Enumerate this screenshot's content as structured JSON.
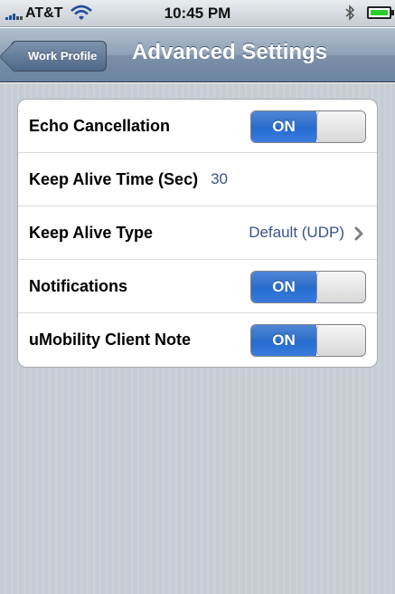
{
  "status_bar": {
    "carrier": "AT&T",
    "time": "10:45 PM",
    "icons": [
      "signal-bars-icon",
      "wifi-icon",
      "bluetooth-icon",
      "battery-icon"
    ]
  },
  "nav_bar": {
    "back_label": "Work Profile",
    "title": "Advanced Settings"
  },
  "settings": {
    "echo_cancellation": {
      "label": "Echo Cancellation",
      "toggle": "ON"
    },
    "keep_alive_time": {
      "label": "Keep Alive Time (Sec)",
      "value": "30"
    },
    "keep_alive_type": {
      "label": "Keep Alive Type",
      "value": "Default (UDP)",
      "icon": "chevron-right-icon"
    },
    "notifications": {
      "label": "Notifications",
      "toggle": "ON"
    },
    "umobility_client_note": {
      "label": "uMobility Client Note",
      "toggle": "ON"
    }
  },
  "colors": {
    "toggle_on": "#2d6ec9",
    "value_text": "#385487",
    "background": "#c5ccd4",
    "nav_bar": "#6c83a0"
  }
}
